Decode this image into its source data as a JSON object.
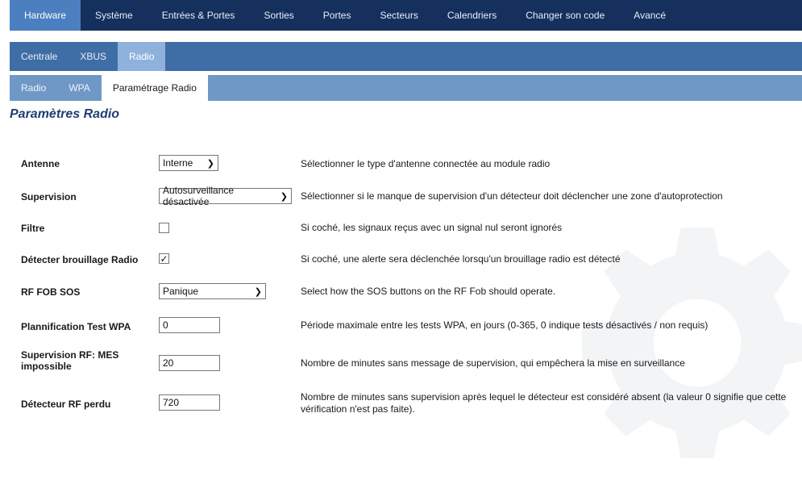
{
  "nav_primary": [
    {
      "label": "Hardware",
      "active": true
    },
    {
      "label": "Système",
      "active": false
    },
    {
      "label": "Entrées & Portes",
      "active": false
    },
    {
      "label": "Sorties",
      "active": false
    },
    {
      "label": "Portes",
      "active": false
    },
    {
      "label": "Secteurs",
      "active": false
    },
    {
      "label": "Calendriers",
      "active": false
    },
    {
      "label": "Changer son code",
      "active": false
    },
    {
      "label": "Avancé",
      "active": false
    }
  ],
  "nav_secondary": [
    {
      "label": "Centrale",
      "active": false
    },
    {
      "label": "XBUS",
      "active": false
    },
    {
      "label": "Radio",
      "active": true
    }
  ],
  "nav_tertiary": [
    {
      "label": "Radio",
      "active": false
    },
    {
      "label": "WPA",
      "active": false
    },
    {
      "label": "Paramétrage Radio",
      "active": true
    }
  ],
  "page_title": "Paramètres Radio",
  "fields": {
    "antenne": {
      "label": "Antenne",
      "value": "Interne",
      "description": "Sélectionner le type d'antenne connectée au module radio"
    },
    "supervision": {
      "label": "Supervision",
      "value": "Autosurveillance désactivée",
      "description": "Sélectionner si le manque de supervision d'un détecteur doit déclencher une zone d'autoprotection"
    },
    "filtre": {
      "label": "Filtre",
      "checked": false,
      "description": "Si coché, les signaux reçus avec un signal nul seront ignorés"
    },
    "brouillage": {
      "label": "Détecter brouillage Radio",
      "checked": true,
      "check_glyph": "✓",
      "description": "Si coché, une alerte sera déclenchée lorsqu'un brouillage radio est détecté"
    },
    "rf_fob_sos": {
      "label": "RF FOB SOS",
      "value": "Panique",
      "description": "Select how the SOS buttons on the RF Fob should operate."
    },
    "test_wpa": {
      "label": "Plannification Test WPA",
      "value": "0",
      "description": "Période maximale entre les tests WPA, en jours (0-365, 0 indique tests désactivés / non requis)"
    },
    "supervision_rf": {
      "label": "Supervision RF: MES impossible",
      "value": "20",
      "description": "Nombre de minutes sans message de supervision, qui empêchera la mise en surveillance"
    },
    "detecteur_perdu": {
      "label": "Détecteur RF perdu",
      "value": "720",
      "description": "Nombre de minutes sans supervision après lequel le détecteur est considéré absent (la valeur 0 signifie que cette vérification n'est pas faite)."
    }
  },
  "colors": {
    "nav_primary_bg": "#15305d",
    "nav_secondary_bg": "#3f6ea6",
    "nav_tertiary_bg": "#6f98c7",
    "title_color": "#1f3d73"
  }
}
